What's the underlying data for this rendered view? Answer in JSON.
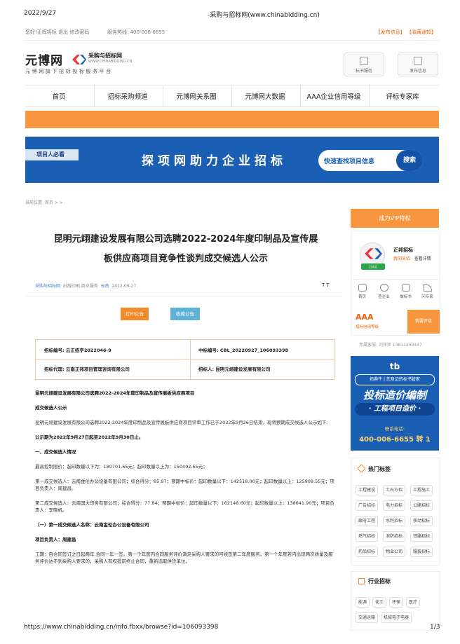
{
  "print_header": {
    "date": "2022/9/27",
    "title": "-采购与招标网(www.chinabidding.cn)"
  },
  "print_footer": {
    "url": "https://www.chinabidding.cn/info.fbxx/browse?id=106093398",
    "page": "1/3"
  },
  "topbar": {
    "greeting": "您好!正辉招标  退出  修改密码",
    "hotline": "服务热线: 400-006-6655",
    "links": "【发布信息】  【收藏通知】"
  },
  "logo": {
    "brand": "元博网",
    "site_name": "采购与招标网",
    "site_domain": "WWW.CHINABIDDING.CN",
    "slogan": "元博网旗下招标投标服务平台"
  },
  "header_buttons": [
    {
      "label": "标书服务",
      "icon": "document-icon"
    },
    {
      "label": "发布信息",
      "icon": "edit-icon"
    }
  ],
  "nav": [
    "首页",
    "招标采购频道",
    "元博网关系圈",
    "元博网大数据",
    "AAA企业信用等级",
    "评标专家库"
  ],
  "banner": {
    "tag": "项目人必看",
    "slogan": "探项网助力企业招标",
    "search_placeholder": "快速查找项目信息",
    "search_button": "搜索"
  },
  "breadcrumb": "当前位置: 首页 > >",
  "article": {
    "title_line1": "昆明元翊建设发展有限公司选聘2022-2024年度印制品及宣传展",
    "title_line2": "板供应商项目竞争性谈判成交候选人公示",
    "source": "采购与招标网",
    "category": "出版印刷,商业服务",
    "region": "云南",
    "date": "2022-09-27",
    "font_size_label": "T T",
    "print_button": "打印公告",
    "fav_button": "收藏公告",
    "info": {
      "bid_no": "招标编号: 云正招字2022046-9",
      "win_no": "中标编号: CBL_20220927_106093398",
      "agent": "招标代理: 云南正邦项目管理咨询有限公司",
      "tenderer": "招标人: 昆明元翊建设发展有限公司"
    },
    "paragraphs": [
      "昆明元翊建设发展有限公司选聘2022-2024年度印制品及宣传展板供应商项目",
      "成交候选人公示",
      "昆明元翊建设发展有限公司选聘2022-2024年度印制品及宣传展板供应商项目评审工作已于2022年9月26日结束，现将预期成交候选人公示如下:",
      "公示期为2022年9月27日起至2022年9月30日止。",
      "一、成交候选人情况",
      "最高控制限价：起印数量以下为：180701.65元；起印数量以上为：150492.65元；",
      "第一成交候选人：云南金伦办公设备有限公司；综合得分：85.97；预期中标价：起印数量以下：142518.00元；起印数量以上：125909.55元；项目负责人：周建昌。",
      "第二成交候选人：云南国大印务有限公司；综合得分：77.84；预期中标价：起印数量以下：162148.60元；起印数量以上：138641.90元；项目负责人：李晓帆。",
      "（一）第一成交候选人名称：云南金伦办公设备有限公司",
      "项目负责人：周建昌",
      "工期：自合同签订之日起两年,合同一年一签。第一个年度内合同服务评价满足采购人要求的可续签第二年度服务。第一个年度若内出现两次质量及服务评价达不到采购人要求的，采购人有权提前终止合同，重新选取供货单位。"
    ]
  },
  "sidebar": {
    "vip_button": "成为VIP特权",
    "company": "正邦招标",
    "my_collect": "我的采招",
    "detail_link": "查看详情",
    "verified": "已认证",
    "quick_icons": [
      {
        "label": "首页",
        "icon": "home-icon"
      },
      {
        "label": "查企业",
        "icon": "eye-icon"
      },
      {
        "label": "做标书",
        "icon": "folder-icon"
      },
      {
        "label": "问专家",
        "icon": "signal-icon"
      }
    ],
    "aaa_title": "AAA",
    "aaa_sub": "招标信用等级",
    "aaa_button": "我要评级",
    "consultant": "专属客服: 刘萍萍 13811259447",
    "ad": {
      "logo": "tb",
      "pill": "拓典牛 | 您身边的标书管家",
      "headline": "投标造价编制",
      "sub": "· 工程项目造价 ·",
      "contact": "联系电话:",
      "phone": "400-006-6655 转 1"
    },
    "hot_tags_title": "热门标签",
    "hot_tags": [
      "工程建设",
      "土石方招",
      "工程施工",
      "广告招标",
      "电力招标",
      "公路招标",
      "政府工程",
      "水利招标",
      "移动招标",
      "燃气招标",
      "消防招标",
      "铁路招标",
      "药品招标",
      "物业公司",
      "服装招标"
    ],
    "industry_title": "行业招标",
    "industry_tags": [
      "能源",
      "化工",
      "环保",
      "医疗",
      "交通运输",
      "机械电子电器"
    ]
  }
}
